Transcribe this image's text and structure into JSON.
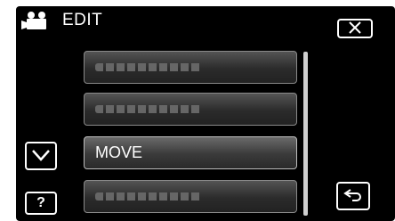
{
  "header": {
    "mode_icon": "movie-camera-icon",
    "title": "EDIT"
  },
  "menu": {
    "items": [
      {
        "label": "",
        "note": "blurred"
      },
      {
        "label": "",
        "note": "blurred"
      },
      {
        "label": "MOVE",
        "note": "selected"
      },
      {
        "label": "",
        "note": "blurred"
      }
    ]
  },
  "buttons": {
    "close": "close-icon",
    "scroll_down": "chevron-down-icon",
    "help": "?",
    "back": "back-arrow-icon"
  },
  "colors": {
    "background": "#000000",
    "item_fill": "#3a3a3a",
    "text": "#ffffff"
  }
}
